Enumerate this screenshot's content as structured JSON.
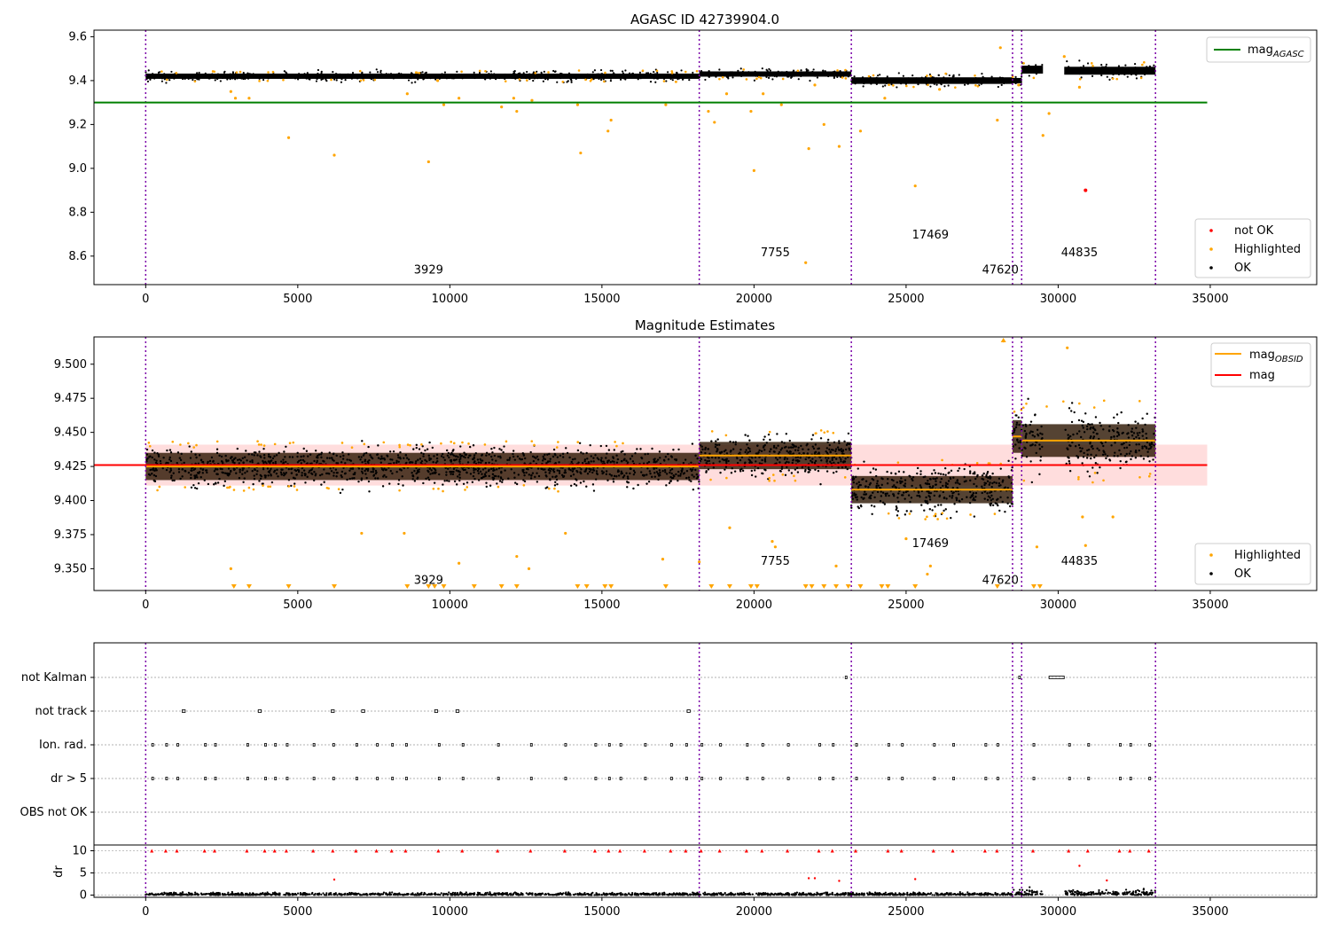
{
  "figure": {
    "background": "#ffffff"
  },
  "colors": {
    "ok": "#000000",
    "highlighted": "#ffa500",
    "not_ok": "#ff0000",
    "agasc_line": "#008000",
    "obsid_line": "#ffa500",
    "mag_line": "#ff0000",
    "mag_band": "#ffdddd",
    "obs_boundary": "#7b00a8",
    "error_band": "#2a1400",
    "grid": "#b0b0b0"
  },
  "observations": {
    "boundaries": [
      0,
      18200,
      23200,
      28500,
      28800,
      33200
    ],
    "ids": [
      "3929",
      "7755",
      "17469",
      "47620",
      "44835"
    ]
  },
  "chart_data": [
    {
      "type": "scatter",
      "title": "AGASC ID 42739904.0",
      "xlim": [
        -1700,
        38500
      ],
      "ylim": [
        8.47,
        9.63
      ],
      "xticks": [
        0,
        5000,
        10000,
        15000,
        20000,
        25000,
        30000,
        35000
      ],
      "yticks": [
        "8.6",
        "8.8",
        "9.0",
        "9.2",
        "9.4",
        "9.6"
      ],
      "mag_agasc": 9.3,
      "line_x": [
        -1700,
        34900
      ],
      "segments": [
        {
          "x": [
            0,
            18200
          ],
          "center": 9.42,
          "spread": 0.02
        },
        {
          "x": [
            18200,
            23200
          ],
          "center": 9.43,
          "spread": 0.02
        },
        {
          "x": [
            23200,
            28500
          ],
          "center": 9.4,
          "spread": 0.025
        },
        {
          "x": [
            28500,
            28800
          ],
          "center": 9.4,
          "spread": 0.02
        },
        {
          "x": [
            28800,
            29500
          ],
          "center": 9.45,
          "spread": 0.03
        },
        {
          "x": [
            30200,
            33200
          ],
          "center": 9.445,
          "spread": 0.03
        }
      ],
      "highlighted_outliers": [
        [
          2800,
          9.35
        ],
        [
          2950,
          9.32
        ],
        [
          3400,
          9.32
        ],
        [
          4700,
          9.14
        ],
        [
          6200,
          9.06
        ],
        [
          8600,
          9.34
        ],
        [
          9300,
          9.03
        ],
        [
          9600,
          9.4
        ],
        [
          9800,
          9.29
        ],
        [
          10300,
          9.32
        ],
        [
          11700,
          9.28
        ],
        [
          12100,
          9.32
        ],
        [
          12200,
          9.26
        ],
        [
          12700,
          9.31
        ],
        [
          14200,
          9.29
        ],
        [
          14300,
          9.07
        ],
        [
          15200,
          9.17
        ],
        [
          15300,
          9.22
        ],
        [
          17100,
          9.29
        ],
        [
          18500,
          9.26
        ],
        [
          18700,
          9.21
        ],
        [
          19100,
          9.34
        ],
        [
          19900,
          9.26
        ],
        [
          20000,
          8.99
        ],
        [
          20300,
          9.34
        ],
        [
          20900,
          9.29
        ],
        [
          21700,
          8.57
        ],
        [
          22000,
          9.38
        ],
        [
          21800,
          9.09
        ],
        [
          22300,
          9.2
        ],
        [
          22800,
          9.1
        ],
        [
          23500,
          9.17
        ],
        [
          24300,
          9.32
        ],
        [
          25300,
          8.92
        ],
        [
          26100,
          9.36
        ],
        [
          28000,
          9.22
        ],
        [
          28100,
          9.55
        ],
        [
          28700,
          9.38
        ],
        [
          29500,
          9.15
        ],
        [
          29700,
          9.25
        ],
        [
          30200,
          9.51
        ],
        [
          30700,
          9.37
        ]
      ],
      "not_ok_points": [
        [
          30900,
          8.9
        ]
      ],
      "labels": [
        {
          "text": "3929",
          "x": 9300,
          "y": 8.52
        },
        {
          "text": "7755",
          "x": 20700,
          "y": 8.6
        },
        {
          "text": "17469",
          "x": 25800,
          "y": 8.68
        },
        {
          "text": "47620",
          "x": 28100,
          "y": 8.52
        },
        {
          "text": "44835",
          "x": 30700,
          "y": 8.6
        }
      ],
      "legend_top": {
        "entries": [
          "mag_AGASC"
        ]
      },
      "legend_bottom": {
        "entries": [
          "not OK",
          "Highlighted",
          "OK"
        ]
      }
    },
    {
      "type": "scatter",
      "title": "Magnitude Estimates",
      "xlim": [
        -1700,
        38500
      ],
      "ylim": [
        9.334,
        9.52
      ],
      "xticks": [
        0,
        5000,
        10000,
        15000,
        20000,
        25000,
        30000,
        35000
      ],
      "yticks": [
        "9.350",
        "9.375",
        "9.400",
        "9.425",
        "9.450",
        "9.475",
        "9.500"
      ],
      "mag": 9.426,
      "mag_band": [
        9.411,
        9.441
      ],
      "line_x": [
        -1700,
        34900
      ],
      "segments": [
        {
          "x": [
            0,
            18200
          ],
          "mag_obsid": 9.425,
          "spread": 0.012,
          "band": 0.01
        },
        {
          "x": [
            18200,
            23200
          ],
          "mag_obsid": 9.433,
          "spread": 0.012,
          "band": 0.01
        },
        {
          "x": [
            23200,
            28500
          ],
          "mag_obsid": 9.408,
          "spread": 0.014,
          "band": 0.01
        },
        {
          "x": [
            28500,
            28800
          ],
          "mag_obsid": 9.447,
          "spread": 0.015,
          "band": 0.012
        },
        {
          "x": [
            28800,
            33200
          ],
          "mag_obsid": 9.444,
          "spread": 0.02,
          "band": 0.012
        }
      ],
      "highlighted_outliers": [
        [
          2800,
          9.35
        ],
        [
          7100,
          9.376
        ],
        [
          8500,
          9.376
        ],
        [
          10300,
          9.354
        ],
        [
          12200,
          9.359
        ],
        [
          12600,
          9.35
        ],
        [
          13800,
          9.376
        ],
        [
          17000,
          9.357
        ],
        [
          18200,
          9.355
        ],
        [
          19200,
          9.38
        ],
        [
          20600,
          9.37
        ],
        [
          20700,
          9.366
        ],
        [
          22700,
          9.352
        ],
        [
          25000,
          9.372
        ],
        [
          25700,
          9.346
        ],
        [
          25800,
          9.352
        ],
        [
          29300,
          9.366
        ],
        [
          30300,
          9.512
        ],
        [
          30800,
          9.388
        ],
        [
          30900,
          9.367
        ],
        [
          31800,
          9.388
        ],
        [
          28200,
          9.517
        ]
      ],
      "clipped_x": [
        2900,
        3400,
        4700,
        6200,
        8600,
        9300,
        9500,
        9800,
        10800,
        11700,
        12200,
        14200,
        14500,
        15100,
        15300,
        17100,
        18600,
        19200,
        19900,
        20100,
        21700,
        21900,
        22300,
        22700,
        23100,
        23500,
        24200,
        24400,
        25300,
        28000,
        29200,
        29400
      ],
      "labels": [
        {
          "text": "3929",
          "x": 9300,
          "y": 9.339
        },
        {
          "text": "7755",
          "x": 20700,
          "y": 9.353
        },
        {
          "text": "17469",
          "x": 25800,
          "y": 9.366
        },
        {
          "text": "47620",
          "x": 28100,
          "y": 9.339
        },
        {
          "text": "44835",
          "x": 30700,
          "y": 9.353
        }
      ],
      "legend_top": {
        "entries": [
          "mag_OBSID",
          "mag"
        ]
      },
      "legend_bottom": {
        "entries": [
          "Highlighted",
          "OK"
        ]
      }
    },
    {
      "type": "scatter",
      "xlim": [
        -1700,
        38500
      ],
      "flag_rows": [
        "not Kalman",
        "not track",
        "Ion. rad.",
        "dr > 5",
        "OBS not OK"
      ],
      "flags": {
        "not Kalman": [
          [
            23000,
            23000
          ],
          [
            28700,
            28700
          ],
          [
            29700,
            30200
          ]
        ],
        "not track": [
          [
            1200,
            1300
          ],
          [
            3700,
            3800
          ],
          [
            6100,
            6200
          ],
          [
            7100,
            7200
          ],
          [
            9500,
            9600
          ],
          [
            10200,
            10300
          ],
          [
            17800,
            17900
          ]
        ],
        "Ion. rad.": "frequent",
        "dr > 5": "frequent",
        "OBS not OK": []
      },
      "dr_ylim": [
        -0.5,
        10.5
      ],
      "dr_yticks": [
        "0",
        "5",
        "10"
      ],
      "dr_ylabel": "dr",
      "xticks": [
        0,
        5000,
        10000,
        15000,
        20000,
        25000,
        30000,
        35000
      ]
    }
  ],
  "tick_labels_x": [
    "0",
    "5000",
    "10000",
    "15000",
    "20000",
    "25000",
    "30000",
    "35000"
  ]
}
